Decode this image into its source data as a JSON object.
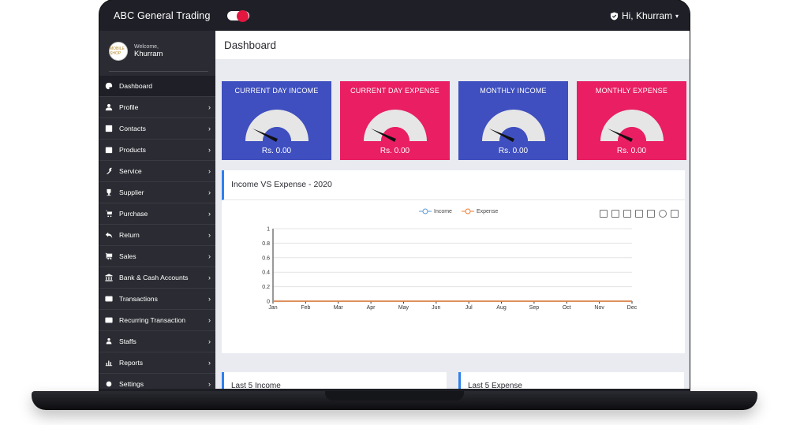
{
  "app": {
    "brand": "ABC General Trading",
    "user_greeting": "Hi, Khurram",
    "toggle_on": true
  },
  "sidebar": {
    "welcome_label": "Welcome,",
    "user_name": "Khurram",
    "avatar_text": "MOBILE SHOP",
    "items": [
      {
        "label": "Dashboard",
        "icon": "palette-icon",
        "active": true,
        "has_submenu": false
      },
      {
        "label": "Profile",
        "icon": "user-icon",
        "active": false,
        "has_submenu": true
      },
      {
        "label": "Contacts",
        "icon": "contact-card-icon",
        "active": false,
        "has_submenu": true
      },
      {
        "label": "Products",
        "icon": "box-icon",
        "active": false,
        "has_submenu": true
      },
      {
        "label": "Service",
        "icon": "wrench-icon",
        "active": false,
        "has_submenu": true
      },
      {
        "label": "Supplier",
        "icon": "trophy-icon",
        "active": false,
        "has_submenu": true
      },
      {
        "label": "Purchase",
        "icon": "cart-icon",
        "active": false,
        "has_submenu": true
      },
      {
        "label": "Return",
        "icon": "return-arrow-icon",
        "active": false,
        "has_submenu": true
      },
      {
        "label": "Sales",
        "icon": "cart-plus-icon",
        "active": false,
        "has_submenu": true
      },
      {
        "label": "Bank & Cash Accounts",
        "icon": "bank-icon",
        "active": false,
        "has_submenu": true
      },
      {
        "label": "Transactions",
        "icon": "credit-card-icon",
        "active": false,
        "has_submenu": true
      },
      {
        "label": "Recurring Transaction",
        "icon": "credit-card-icon",
        "active": false,
        "has_submenu": true
      },
      {
        "label": "Staffs",
        "icon": "users-icon",
        "active": false,
        "has_submenu": true
      },
      {
        "label": "Reports",
        "icon": "bar-chart-icon",
        "active": false,
        "has_submenu": true
      },
      {
        "label": "Settings",
        "icon": "gear-icon",
        "active": false,
        "has_submenu": true
      }
    ]
  },
  "main": {
    "page_title": "Dashboard",
    "cards": [
      {
        "title": "CURRENT DAY INCOME",
        "value": "Rs. 0.00",
        "color": "#3f4fbf"
      },
      {
        "title": "CURRENT DAY EXPENSE",
        "value": "Rs. 0.00",
        "color": "#e91e63"
      },
      {
        "title": "MONTHLY INCOME",
        "value": "Rs. 0.00",
        "color": "#3f4fbf"
      },
      {
        "title": "MONTHLY EXPENSE",
        "value": "Rs. 0.00",
        "color": "#e91e63"
      }
    ],
    "chart_panel_title": "Income VS Expense - 2020",
    "bottom_panels": [
      "Last 5 Income",
      "Last 5 Expense"
    ]
  },
  "chart_data": {
    "type": "line",
    "title": "Income VS Expense - 2020",
    "categories": [
      "Jan",
      "Feb",
      "Mar",
      "Apr",
      "May",
      "Jun",
      "Jul",
      "Aug",
      "Sep",
      "Oct",
      "Nov",
      "Dec"
    ],
    "series": [
      {
        "name": "Income",
        "values": [
          0,
          0,
          0,
          0,
          0,
          0,
          0,
          0,
          0,
          0,
          0,
          0
        ],
        "color": "#5b9bd5"
      },
      {
        "name": "Expense",
        "values": [
          0,
          0,
          0,
          0,
          0,
          0,
          0,
          0,
          0,
          0,
          0,
          0
        ],
        "color": "#ed7d31"
      }
    ],
    "yticks": [
      "0",
      "0.2",
      "0.4",
      "0.6",
      "0.8",
      "1"
    ],
    "ylim": [
      0,
      1
    ],
    "grid": true,
    "legend_position": "top-center"
  },
  "colors": {
    "accent_blue": "#2f80ed",
    "sidebar_bg": "#2b2c33",
    "topbar_bg": "#1f2027",
    "toggle_red": "#e2173f"
  }
}
